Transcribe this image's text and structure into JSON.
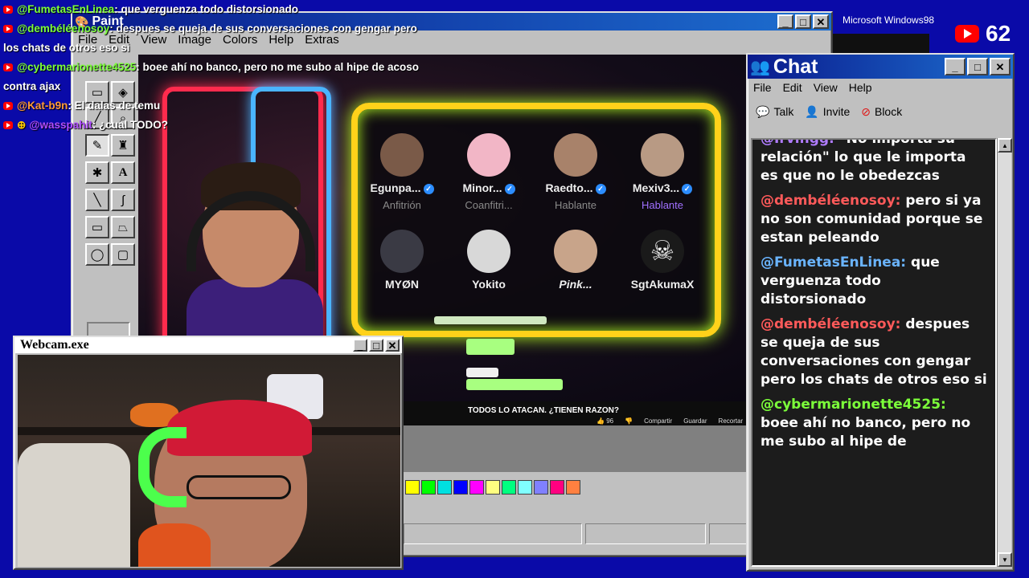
{
  "overlay_chat": [
    {
      "user": "@FumetasEnLinea",
      "user_color": "#7cff3a",
      "text": ": que verguenza todo distorsionado"
    },
    {
      "user": "@dembéléenosoy",
      "user_color": "#7cff3a",
      "text": ": despues se queja de sus conversaciones con gengar pero"
    },
    {
      "user": "",
      "user_color": "#fff",
      "text": "los chats de otros eso si"
    },
    {
      "user": "@cybermarionette4525",
      "user_color": "#7cff3a",
      "text": ": boee ahí no banco, pero no me subo al hipe de acoso"
    },
    {
      "user": "",
      "user_color": "#fff",
      "text": "contra ajax"
    },
    {
      "user": "@Kat-b9n",
      "user_color": "#ff9a3a",
      "text": ": El dalas de temu"
    },
    {
      "user": "@wasspahit",
      "user_color": "#b04dff",
      "text": ": ¿cual TODO?"
    }
  ],
  "paint": {
    "title": "Paint",
    "menu": [
      "File",
      "Edit",
      "View",
      "Image",
      "Colors",
      "Help",
      "Extras"
    ],
    "palette": [
      "#ffff00",
      "#00ff00",
      "#00e0e0",
      "#0000ff",
      "#ff00ff",
      "#ffff80",
      "#00ff80",
      "#80ffff",
      "#8080ff",
      "#ff0080",
      "#ff8040"
    ]
  },
  "stream_panel": {
    "members": [
      {
        "name": "Egunpa...",
        "role": "Anfitrión",
        "avatar": "#7a5a48"
      },
      {
        "name": "Minor...",
        "role": "Coanfitri...",
        "avatar": "#f2b6c6"
      },
      {
        "name": "Raedto...",
        "role": "Hablante",
        "avatar": "#a8826a"
      },
      {
        "name": "Mexiv3...",
        "role": "Hablante",
        "avatar": "#b89a84"
      },
      {
        "name": "MYØN",
        "role": "",
        "avatar": "#3a3a44"
      },
      {
        "name": "Yokito",
        "role": "",
        "avatar": "#d8d8d8"
      },
      {
        "name": "Pink...",
        "role": "",
        "avatar": "#c8a48a"
      },
      {
        "name": "SgtAkumaX",
        "role": "",
        "avatar": "#1a1a1a"
      }
    ]
  },
  "video": {
    "title": "TODOS LO ATACAN. ¿TIENEN RAZON?",
    "likes": "96",
    "actions": [
      "Compartir",
      "Guardar",
      "Recortar"
    ]
  },
  "chat_window": {
    "title": "Chat",
    "menu": [
      "File",
      "Edit",
      "View",
      "Help"
    ],
    "tools": [
      "Talk",
      "Invite",
      "Block"
    ],
    "messages": [
      {
        "user": "@Irvingg:",
        "user_color": "#b07cff",
        "text": "\"No importa su relación\" lo que le importa es que no le obedezcas"
      },
      {
        "user": "@dembéléenosoy:",
        "user_color": "#ff5a5a",
        "text": "pero si ya no son comunidad porque se estan peleando"
      },
      {
        "user": "@FumetasEnLinea:",
        "user_color": "#6ab4ff",
        "text": "que verguenza todo distorsionado"
      },
      {
        "user": "@dembéléenosoy:",
        "user_color": "#ff5a5a",
        "text": "despues se queja de sus conversaciones con gengar pero los chats de otros eso si"
      },
      {
        "user": "@cybermarionette4525:",
        "user_color": "#7cff3a",
        "text": "boee ahí no banco, pero no me subo al hipe de"
      }
    ]
  },
  "webcam": {
    "title": "Webcam.exe"
  },
  "top_right": {
    "logo": "Microsoft Windows98",
    "viewers": "62"
  }
}
